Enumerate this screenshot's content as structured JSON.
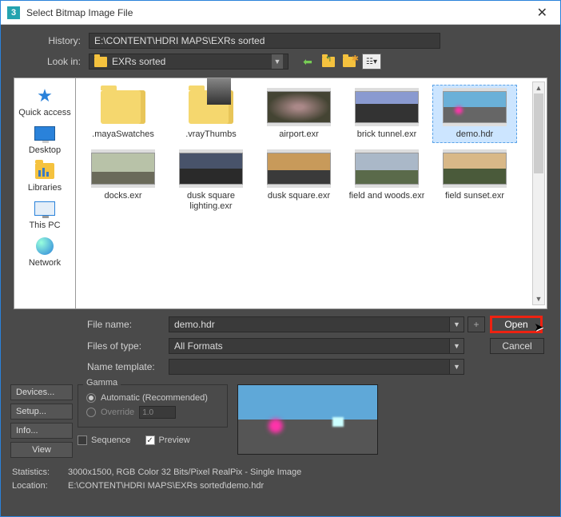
{
  "title": "Select Bitmap Image File",
  "history": {
    "label": "History:",
    "value": "E:\\CONTENT\\HDRI MAPS\\EXRs sorted"
  },
  "lookin": {
    "label": "Look in:",
    "value": "EXRs sorted"
  },
  "sidebar": [
    {
      "label": "Quick access"
    },
    {
      "label": "Desktop"
    },
    {
      "label": "Libraries"
    },
    {
      "label": "This PC"
    },
    {
      "label": "Network"
    }
  ],
  "files": [
    {
      "label": ".mayaSwatches",
      "type": "folder"
    },
    {
      "label": ".vrayThumbs",
      "type": "folder"
    },
    {
      "label": "airport.exr",
      "type": "img",
      "thumb": "t-airport"
    },
    {
      "label": "brick tunnel.exr",
      "type": "img",
      "thumb": "t-brick"
    },
    {
      "label": "demo.hdr",
      "type": "img",
      "thumb": "t-demo",
      "selected": true
    },
    {
      "label": "docks.exr",
      "type": "img",
      "thumb": "t-dock"
    },
    {
      "label": "dusk square lighting.exr",
      "type": "img",
      "thumb": "t-dusk"
    },
    {
      "label": "dusk square.exr",
      "type": "img",
      "thumb": "t-dusk2"
    },
    {
      "label": "field and woods.exr",
      "type": "img",
      "thumb": "t-field"
    },
    {
      "label": "field sunset.exr",
      "type": "img",
      "thumb": "t-sunset"
    }
  ],
  "form": {
    "filename_label": "File name:",
    "filename_value": "demo.hdr",
    "filetype_label": "Files of type:",
    "filetype_value": "All Formats",
    "template_label": "Name template:",
    "template_value": "",
    "open": "Open",
    "cancel": "Cancel",
    "plus": "+"
  },
  "buttons": {
    "devices": "Devices...",
    "setup": "Setup...",
    "info": "Info...",
    "view": "View"
  },
  "gamma": {
    "legend": "Gamma",
    "auto": "Automatic (Recommended)",
    "override": "Override",
    "override_value": "1.0",
    "sequence": "Sequence",
    "preview": "Preview"
  },
  "stats": {
    "stat_label": "Statistics:",
    "stat_value": "3000x1500, RGB Color 32 Bits/Pixel RealPix - Single Image",
    "loc_label": "Location:",
    "loc_value": "E:\\CONTENT\\HDRI MAPS\\EXRs sorted\\demo.hdr"
  }
}
